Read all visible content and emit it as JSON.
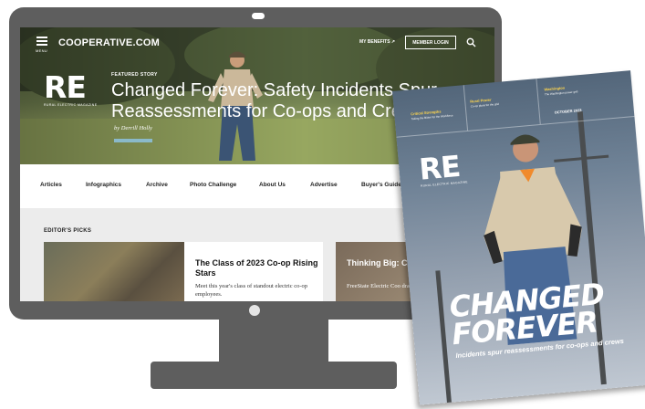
{
  "site": {
    "name": "COOPERATIVE.COM",
    "menu_label": "MENU",
    "my_benefits": "MY BENEFITS",
    "member_login": "MEMBER LOGIN"
  },
  "hero": {
    "logo": "RE",
    "logo_sub": "RURAL ELECTRIC MAGAZINE",
    "featured_label": "FEATURED STORY",
    "headline": "Changed Forever: Safety Incidents Spur Reassessments for Co-ops and Crews",
    "byline": "by Derrill Holly"
  },
  "menu": [
    "Articles",
    "Infographics",
    "Archive",
    "Photo Challenge",
    "About Us",
    "Advertise",
    "Buyer's Guide"
  ],
  "picks": {
    "label": "EDITOR'S PICKS",
    "cards": [
      {
        "title": "The Class of 2023 Co-op Rising Stars",
        "desc": "Meet this year's class of standout electric co-op employees."
      },
      {
        "title": "Thinking Big: C Zoo",
        "desc": "FreeState Electric Coo draws a crowd with its"
      }
    ]
  },
  "magazine": {
    "logo": "RE",
    "logo_sub": "RURAL ELECTRIC MAGAZINE",
    "toc": [
      {
        "head": "Critical Strengths",
        "sub": "Taking the Biden for the Workforce"
      },
      {
        "head": "Rural Power",
        "sub": "Co-op plans for the grid"
      },
      {
        "head": "Washington",
        "sub": "The Washington power grid"
      }
    ],
    "issue": "OCTOBER 2023",
    "headline_1": "CHANGED",
    "headline_2": "FOREVER",
    "subhead": "Incidents spur reassessments for co-ops and crews"
  },
  "colors": {
    "monitor": "#5e5e5e",
    "accent_yellow": "#ffd64d"
  }
}
